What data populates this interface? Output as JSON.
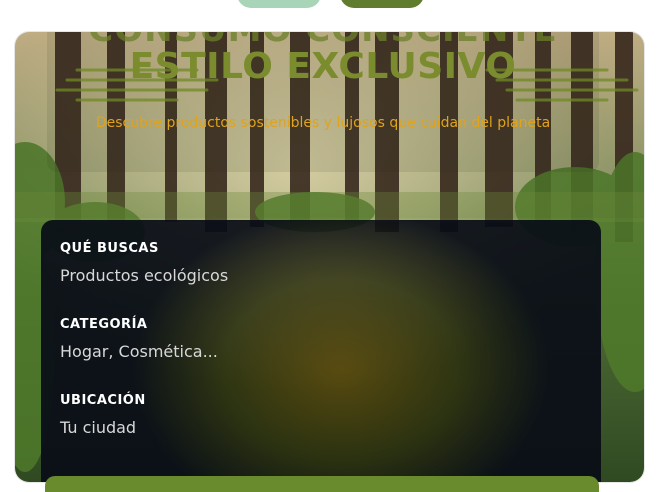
{
  "hero": {
    "title_ghost": "CONSUMO CONSCIENTE",
    "title": "ESTILO EXCLUSIVO",
    "subtitle": "Descubre productos sostenibles y lujosos que cuidan del planeta"
  },
  "search": {
    "fields": [
      {
        "label": "QUÉ BUSCAS",
        "placeholder": "Productos ecológicos"
      },
      {
        "label": "CATEGORÍA",
        "placeholder": "Hogar, Cosmética..."
      },
      {
        "label": "UBICACIÓN",
        "placeholder": "Tu ciudad"
      }
    ]
  },
  "colors": {
    "accent_green": "#6a8a2e",
    "title_olive": "#7b8c2e",
    "subtitle_gold": "#e0a31c",
    "pill_mint": "#a8d5b8"
  }
}
